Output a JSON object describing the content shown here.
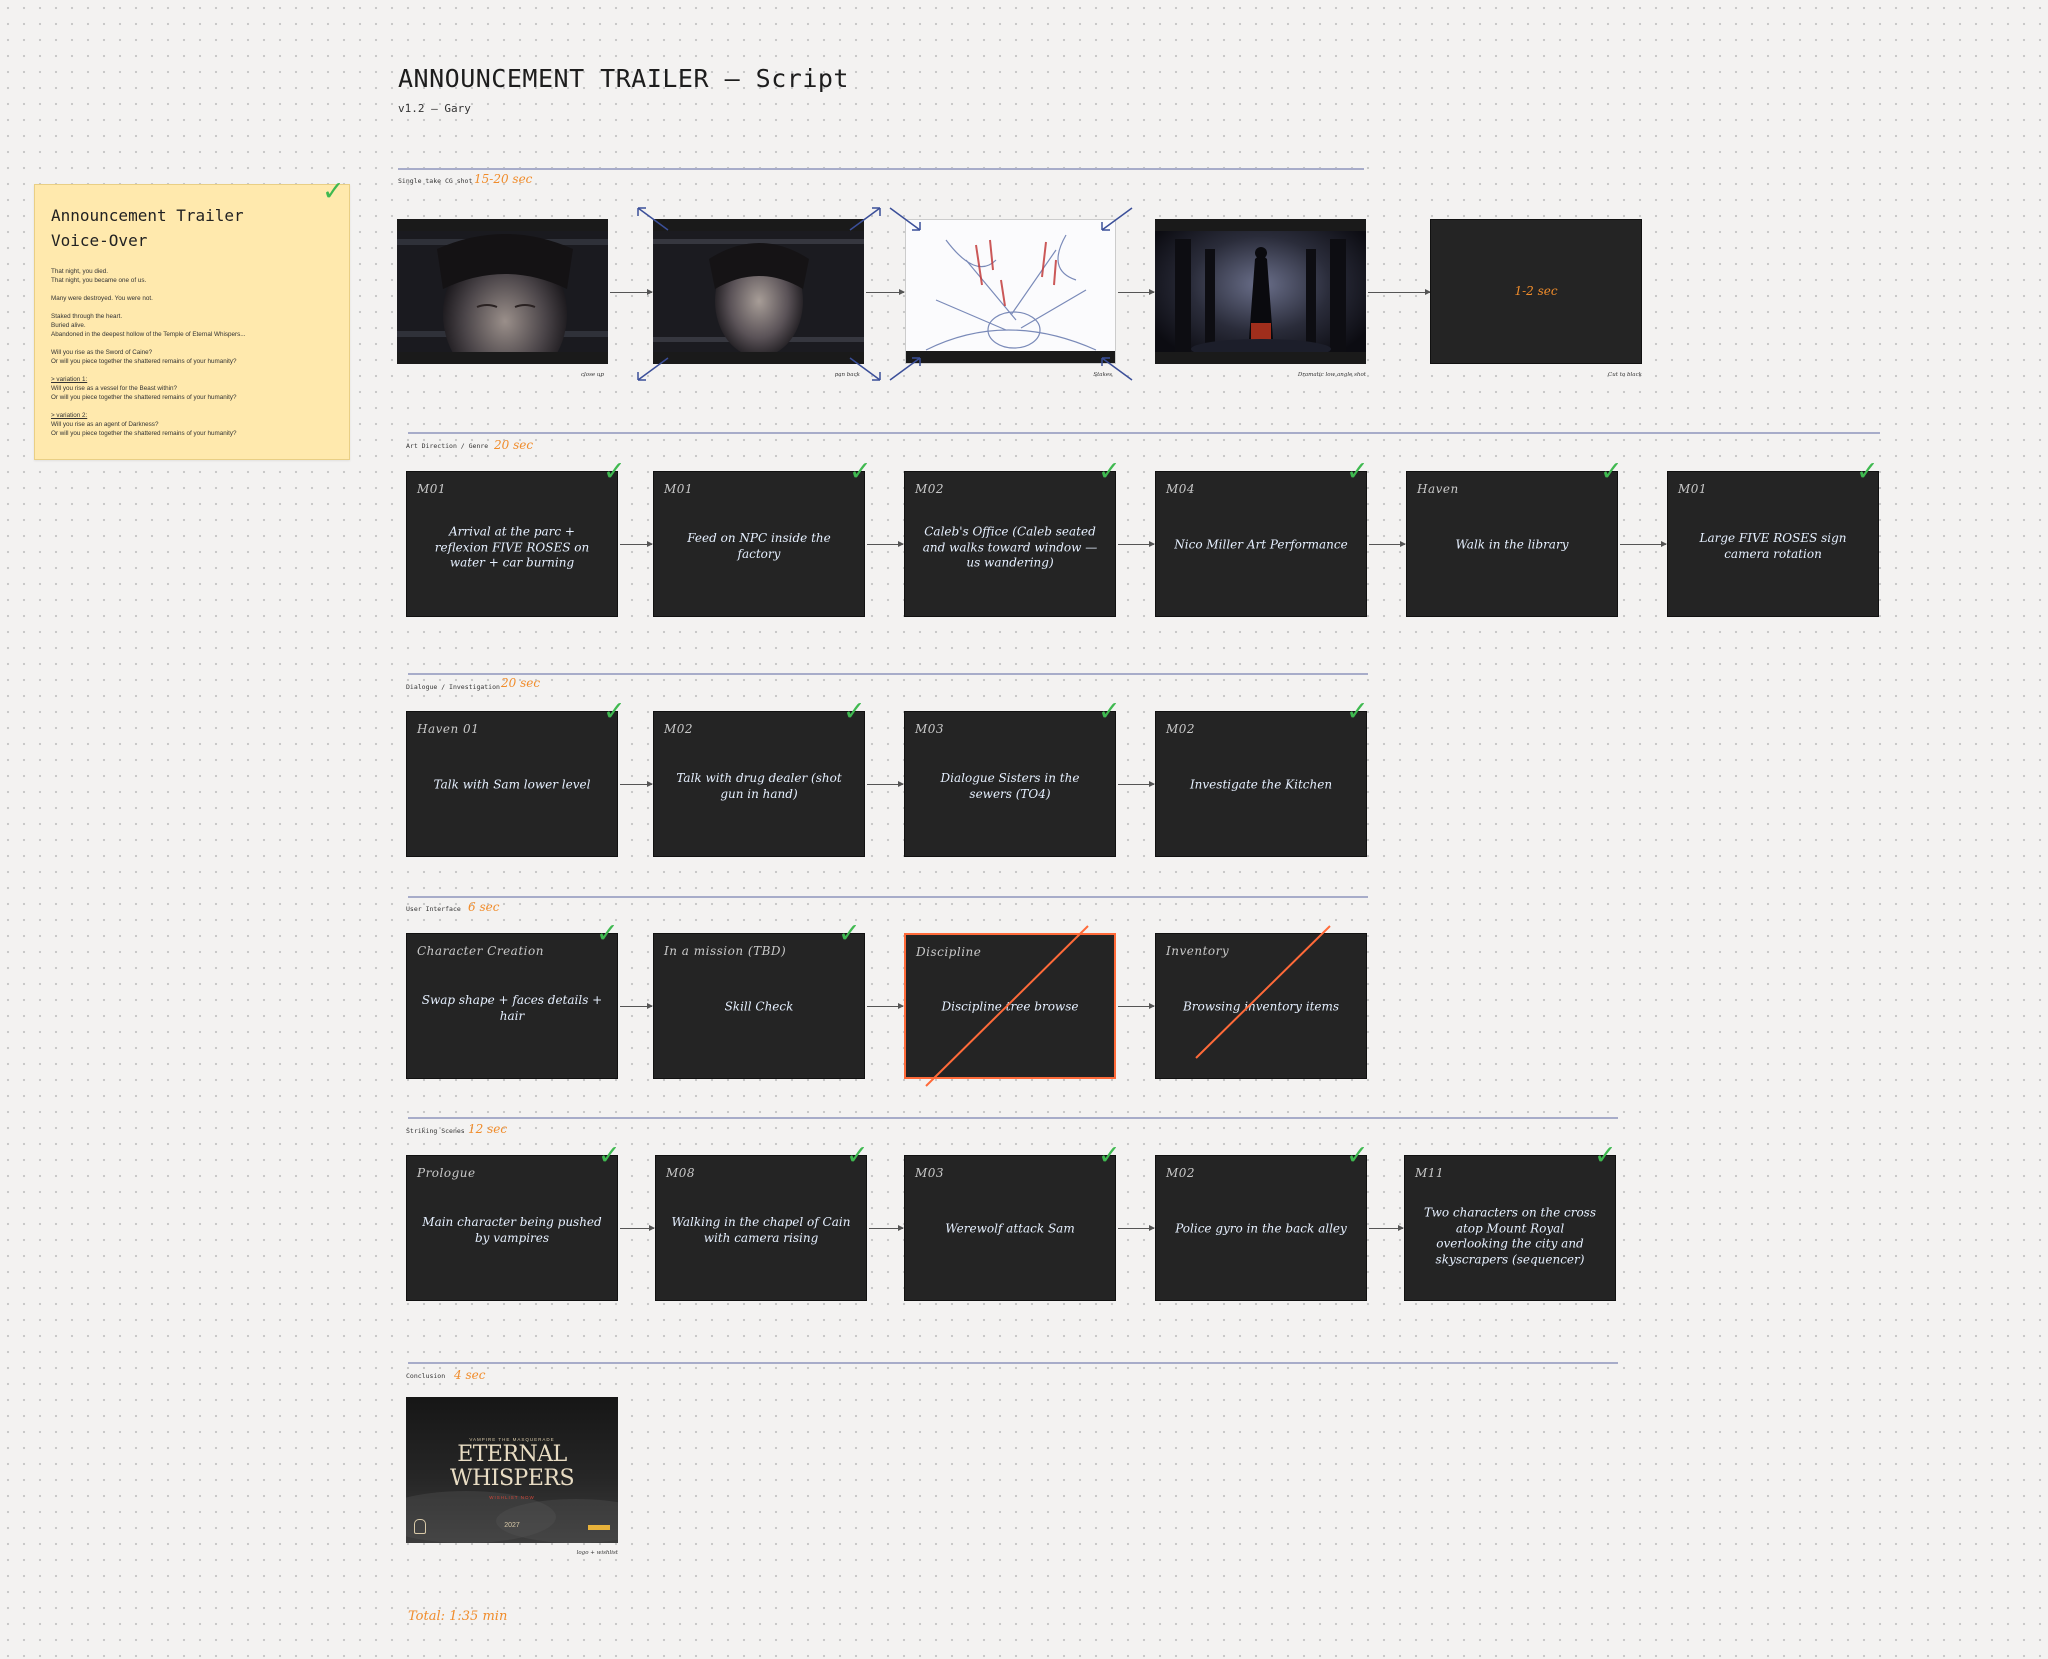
{
  "header": {
    "title": "ANNOUNCEMENT TRAILER — Script",
    "subtitle": "v1.2 — Gary"
  },
  "voiceover": {
    "title": "Announcement Trailer Voice-Over",
    "lines": [
      "That night, you died.",
      "That night, you became one of us.",
      "",
      "Many were destroyed. You were not.",
      "",
      "Staked through the heart.",
      "Buried alive.",
      "Abandoned in the deepest hollow of the Temple of Eternal Whispers...",
      "",
      "Will you rise as the Sword of Caine?",
      "Or will you piece together the shattered remains of your humanity?",
      "",
      "> variation 1:",
      "Will you rise as a vessel for the Beast within?",
      "Or will you piece together the shattered remains of your humanity?",
      "",
      "> variation 2:",
      "Will you rise as an agent of Darkness?",
      "Or will you piece together the shattered remains of your humanity?"
    ]
  },
  "sections": [
    {
      "label": "Single take CG shot",
      "duration": "15-20 sec",
      "cards": [
        {
          "caption": "close up",
          "image": "face-closeup-eyes-closed"
        },
        {
          "caption": "pan back",
          "image": "face-closeup-pan-back"
        },
        {
          "caption": "Stakes",
          "image": "sketch-stakes-blood"
        },
        {
          "caption": "Dramatic low angle shot",
          "image": "cathedral-dark-figure"
        },
        {
          "caption": "Cut to black",
          "text": "1-2 sec"
        }
      ]
    },
    {
      "label": "Art Direction / Genre",
      "duration": "20 sec",
      "cards": [
        {
          "tag": "M01",
          "desc": "Arrival at the parc + reflexion FIVE ROSES on water + car burning"
        },
        {
          "tag": "M01",
          "desc": "Feed on NPC inside the factory"
        },
        {
          "tag": "M02",
          "desc": "Caleb's Office (Caleb seated and walks toward window — us wandering)"
        },
        {
          "tag": "M04",
          "desc": "Nico Miller Art Performance"
        },
        {
          "tag": "Haven",
          "desc": "Walk in the library"
        },
        {
          "tag": "M01",
          "desc": "Large FIVE ROSES sign camera rotation"
        }
      ]
    },
    {
      "label": "Dialogue / Investigation",
      "duration": "20 sec",
      "cards": [
        {
          "tag": "Haven 01",
          "desc": "Talk with Sam lower level"
        },
        {
          "tag": "M02",
          "desc": "Talk with drug dealer (shot gun in hand)"
        },
        {
          "tag": "M03",
          "desc": "Dialogue Sisters in the sewers (TO4)"
        },
        {
          "tag": "M02",
          "desc": "Investigate the Kitchen"
        }
      ]
    },
    {
      "label": "User Interface",
      "duration": "6 sec",
      "cards": [
        {
          "tag": "Character Creation",
          "desc": "Swap shape + faces details + hair"
        },
        {
          "tag": "In a mission (TBD)",
          "desc": "Skill Check"
        },
        {
          "tag": "Discipline",
          "desc": "Discipline tree browse"
        },
        {
          "tag": "Inventory",
          "desc": "Browsing inventory items"
        }
      ]
    },
    {
      "label": "Striking Scenes",
      "duration": "12 sec",
      "cards": [
        {
          "tag": "Prologue",
          "desc": "Main character being pushed by vampires"
        },
        {
          "tag": "M08",
          "desc": "Walking in the chapel of Cain with camera rising"
        },
        {
          "tag": "M03",
          "desc": "Werewolf attack Sam"
        },
        {
          "tag": "M02",
          "desc": "Police gyro in the back alley"
        },
        {
          "tag": "M11",
          "desc": "Two characters on the cross atop Mount Royal overlooking the city and skyscrapers (sequencer)"
        }
      ]
    },
    {
      "label": "Conclusion",
      "duration": "4 sec",
      "cards": [
        {
          "caption": "logo + wishlist",
          "poster": {
            "brand": "VAMPIRE THE MASQUERADE",
            "title_1": "ETERNAL",
            "title_2": "WHISPERS",
            "cta": "WISHLIST NOW",
            "year": "2027"
          }
        }
      ]
    }
  ],
  "total": "Total: 1:35 min",
  "colors": {
    "accent": "#f08c2b",
    "check": "#3fb950",
    "strike": "#ff6a39",
    "card": "#242424",
    "divider": "#a7acc9"
  }
}
